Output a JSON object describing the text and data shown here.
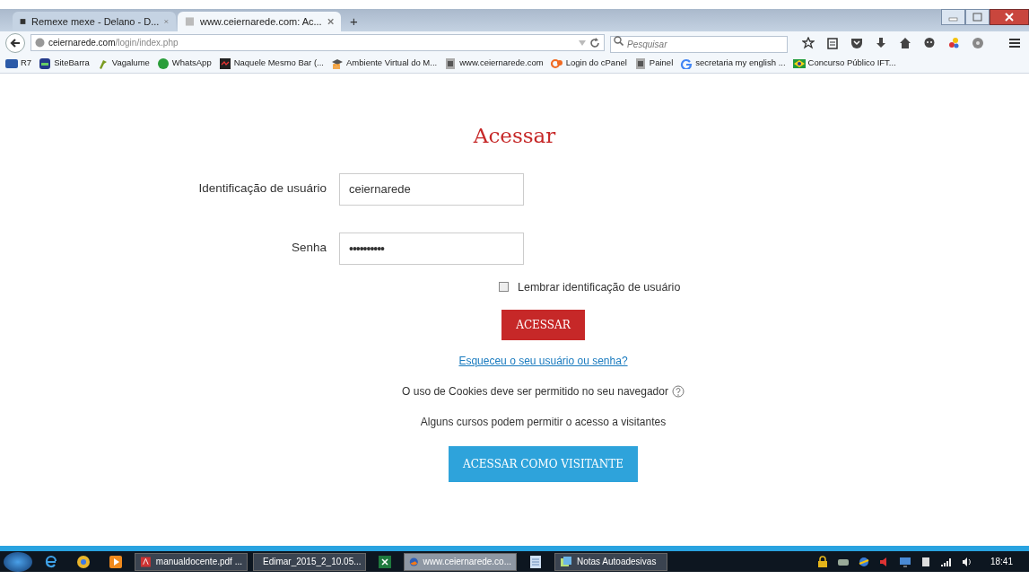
{
  "browser": {
    "tabs": [
      {
        "title": "Remexe mexe - Delano - D...",
        "selected": false
      },
      {
        "title": "www.ceiernarede.com: Ac...",
        "selected": true
      }
    ],
    "new_tab": "+",
    "address": {
      "host": "ceiernarede.com",
      "path": "/login/index.php"
    },
    "search": {
      "placeholder": "Pesquisar"
    },
    "bookmarks": [
      {
        "label": "R7"
      },
      {
        "label": "SiteBarra"
      },
      {
        "label": "Vagalume"
      },
      {
        "label": "WhatsApp"
      },
      {
        "label": "Naquele Mesmo Bar (..."
      },
      {
        "label": "Ambiente Virtual do M..."
      },
      {
        "label": "www.ceiernarede.com"
      },
      {
        "label": "Login do cPanel"
      },
      {
        "label": "Painel"
      },
      {
        "label": "secretaria my english ..."
      },
      {
        "label": "Concurso Público IFT..."
      }
    ]
  },
  "login": {
    "title": "Acessar",
    "fields": [
      {
        "label": "Identificação de usuário",
        "value": "ceiernarede",
        "kind": "text"
      },
      {
        "label": "Senha",
        "value": "••••••••••",
        "kind": "password"
      }
    ],
    "remember": {
      "label": "Lembrar identificação de usuário",
      "checked": false
    },
    "submit": "ACESSAR",
    "forgot": "Esqueceu o seu usuário ou senha?",
    "cookies_note": "O uso de Cookies deve ser permitido no seu navegador",
    "guests_note": "Alguns cursos podem permitir o acesso a visitantes",
    "guest_button": "ACESSAR COMO VISITANTE"
  },
  "taskbar": {
    "items": [
      {
        "label": "manualdocente.pdf ...",
        "selected": false
      },
      {
        "label": "Edimar_2015_2_10.05...",
        "selected": false
      },
      {
        "label": "www.ceiernarede.co...",
        "selected": true
      },
      {
        "label": "Notas Autoadesivas",
        "selected": false
      }
    ],
    "clock": "18:41"
  }
}
